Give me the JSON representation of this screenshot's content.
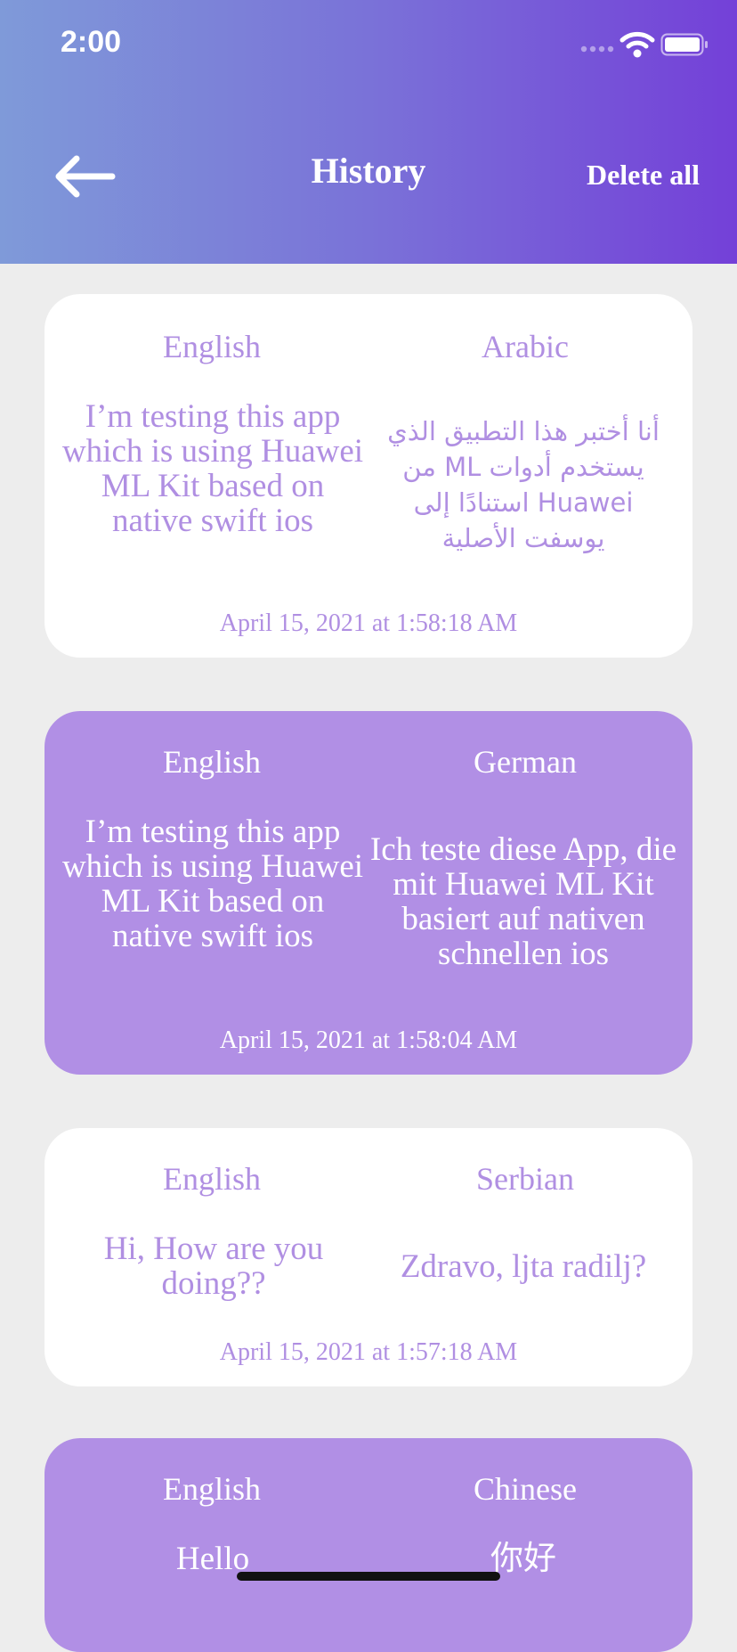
{
  "status_bar": {
    "time": "2:00"
  },
  "nav": {
    "title": "History",
    "delete_all": "Delete all"
  },
  "history": [
    {
      "source_lang": "English",
      "target_lang": "Arabic",
      "source_text": "I’m testing this app which is using Huawei ML Kit based on native swift ios",
      "target_text": "أنا أختبر هذا التطبيق الذي يستخدم أدوات ML من Huawei استنادًا إلى يوسفت الأصلية",
      "date": "April 15, 2021 at 1:58:18 AM"
    },
    {
      "source_lang": "English",
      "target_lang": "German",
      "source_text": "I’m testing this app which is using Huawei ML Kit based on native swift ios",
      "target_text": "Ich teste diese App, die mit Huawei ML Kit basiert auf nativen schnellen ios",
      "date": "April 15, 2021 at 1:58:04 AM"
    },
    {
      "source_lang": "English",
      "target_lang": "Serbian",
      "source_text": "Hi, How are you doing??",
      "target_text": "Zdravo, ljta radilj?",
      "date": "April 15, 2021 at 1:57:18 AM"
    },
    {
      "source_lang": "English",
      "target_lang": "Chinese",
      "source_text": "Hello",
      "target_text": "你好",
      "date": ""
    }
  ],
  "colors": {
    "header_gradient_start": "#7f9ad9",
    "header_gradient_end": "#7440d8",
    "accent_purple": "#b18fe5",
    "text_purple": "#b08fe2",
    "background": "#ededed"
  },
  "icons": {
    "back": "arrow-left-icon",
    "signal": "cellular-signal-icon",
    "wifi": "wifi-icon",
    "battery": "battery-icon"
  }
}
